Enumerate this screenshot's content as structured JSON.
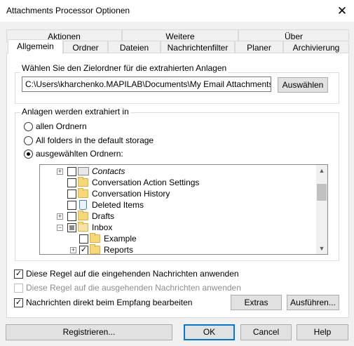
{
  "window": {
    "title": "Attachments Processor Optionen",
    "close_glyph": "✕"
  },
  "tabs": {
    "row1": [
      "Aktionen",
      "Weitere",
      "Über"
    ],
    "row2": [
      "Allgemein",
      "Ordner",
      "Dateien",
      "Nachrichtenfilter",
      "Planer",
      "Archivierung"
    ],
    "selected": "Allgemein"
  },
  "target_folder": {
    "legend": "Wählen Sie den Zielordner für die extrahierten Anlagen",
    "path_value": "C:\\Users\\kharchenko.MAPILAB\\Documents\\My Email Attachments",
    "select_button": "Auswählen"
  },
  "extract_from": {
    "legend": "Anlagen werden extrahiert in",
    "options": [
      "allen Ordnern",
      "All folders in the default storage",
      "ausgewählten Ordnern:"
    ],
    "selected_index": 2
  },
  "folder_tree": {
    "items": [
      {
        "label": "Contacts",
        "italic": true,
        "checked": false,
        "icon": "contacts-icon"
      },
      {
        "label": "Conversation Action Settings",
        "checked": false,
        "icon": "folder-icon"
      },
      {
        "label": "Conversation History",
        "checked": false,
        "icon": "folder-icon"
      },
      {
        "label": "Deleted Items",
        "checked": false,
        "icon": "recycle-bin-icon"
      },
      {
        "label": "Drafts",
        "checked": false,
        "icon": "folder-icon"
      },
      {
        "label": "Inbox",
        "checked": "partial",
        "icon": "inbox-icon"
      },
      {
        "label": "Example",
        "checked": false,
        "icon": "folder-icon"
      },
      {
        "label": "Reports",
        "checked": true,
        "icon": "folder-icon"
      }
    ]
  },
  "options": {
    "incoming": {
      "label": "Diese Regel auf die eingehenden Nachrichten anwenden",
      "checked": true
    },
    "outgoing": {
      "label": "Diese Regel auf die ausgehenden Nachrichten anwenden",
      "checked": false,
      "disabled": true
    },
    "on_receive": {
      "label": "Nachrichten direkt beim Empfang bearbeiten",
      "checked": true
    }
  },
  "action_buttons": {
    "extras": "Extras",
    "run": "Ausführen..."
  },
  "footer": {
    "register": "Registrieren...",
    "ok": "OK",
    "cancel": "Cancel",
    "help": "Help"
  },
  "colors": {
    "accent": "#0078d7",
    "folder": "#f8d775",
    "panel": "#ffffff",
    "dialog": "#f0f0f0"
  }
}
